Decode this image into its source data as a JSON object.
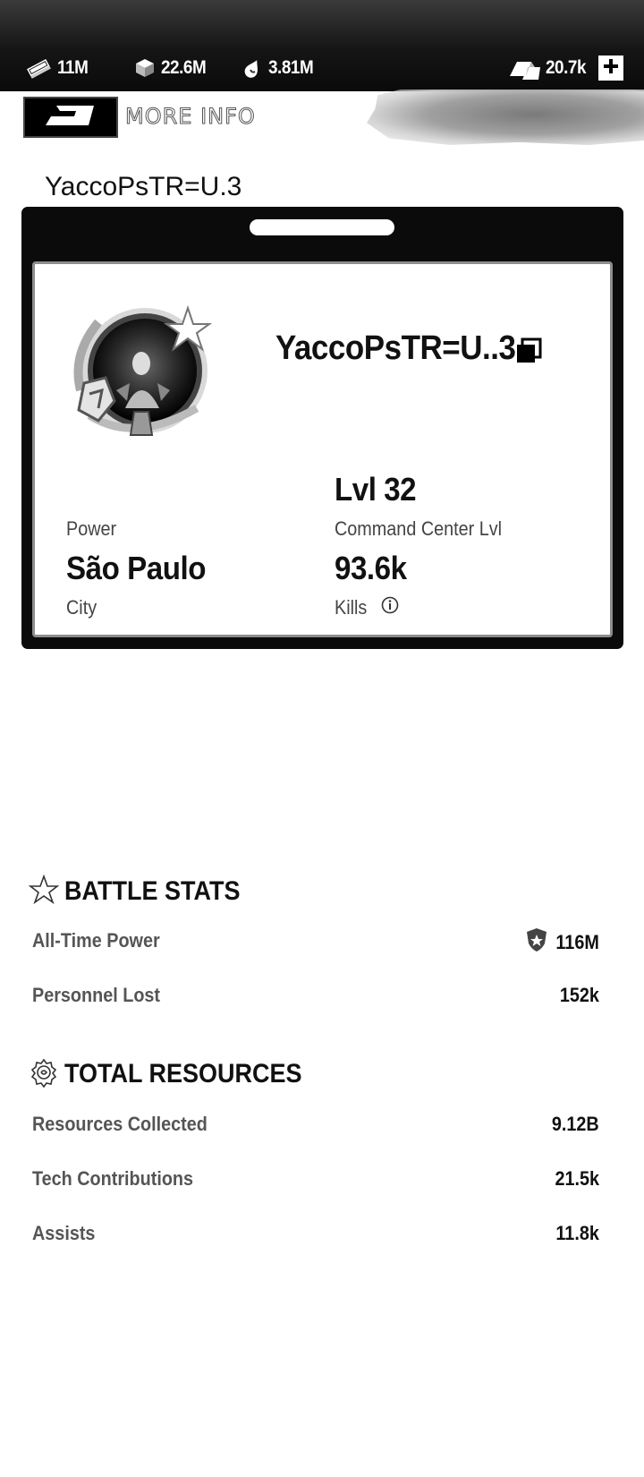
{
  "resources": [
    {
      "icon": "money-stack-icon",
      "value": "11M"
    },
    {
      "icon": "supply-crate-icon",
      "value": "22.6M"
    },
    {
      "icon": "fuel-drop-icon",
      "value": "3.81M"
    }
  ],
  "premium": {
    "icon": "gold-bars-icon",
    "value": "20.7k",
    "add_icon": "plus-icon"
  },
  "more_info": {
    "label": "MORE INFO",
    "icon": "arrow-back-icon"
  },
  "player_title": "YaccoPsTR=U.3",
  "profile": {
    "username": "YaccoPsTR=U..3",
    "copy_icon": "copy-icon",
    "command_center_level": "Lvl 32",
    "command_center_label": "Command Center Lvl",
    "power_label": "Power",
    "city_value": "São Paulo",
    "city_label": "City",
    "kills_value": "93.6k",
    "kills_label": "Kills",
    "kills_info_icon": "info-icon"
  },
  "battle_stats": {
    "title": "BATTLE STATS",
    "icon": "star-icon",
    "rows": [
      {
        "label": "All-Time Power",
        "value": "116M",
        "icon": "power-shield-icon"
      },
      {
        "label": "Personnel Lost",
        "value": "152k"
      }
    ]
  },
  "total_resources": {
    "title": "TOTAL RESOURCES",
    "icon": "gear-icon",
    "rows": [
      {
        "label": "Resources Collected",
        "value": "9.12B"
      },
      {
        "label": "Tech Contributions",
        "value": "21.5k"
      },
      {
        "label": "Assists",
        "value": "11.8k"
      }
    ]
  }
}
